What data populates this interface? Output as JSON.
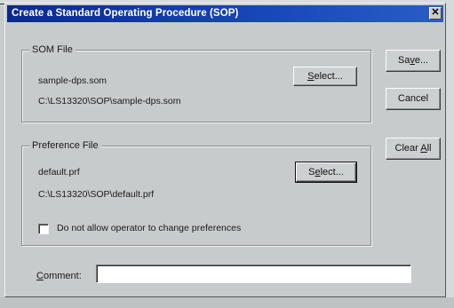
{
  "dialog": {
    "title": "Create a Standard Operating Procedure (SOP)",
    "close_glyph": "✕"
  },
  "som_file": {
    "legend": "SOM File",
    "filename": "sample-dps.som",
    "path": "C:\\LS13320\\SOP\\sample-dps.som",
    "select_prefix": "",
    "select_mnemonic": "S",
    "select_suffix": "elect..."
  },
  "preference_file": {
    "legend": "Preference File",
    "filename": "default.prf",
    "path": "C:\\LS13320\\SOP\\default.prf",
    "select_prefix": "S",
    "select_mnemonic": "e",
    "select_suffix": "lect...",
    "checkbox_label": "Do not allow operator to change preferences",
    "checkbox_checked": false
  },
  "comment": {
    "label_mnemonic": "C",
    "label_rest": "omment:",
    "value": ""
  },
  "buttons": {
    "save_prefix": "Sa",
    "save_mnemonic": "v",
    "save_suffix": "e...",
    "cancel": "Cancel",
    "clear_prefix": "Clear ",
    "clear_mnemonic": "A",
    "clear_suffix": "ll"
  },
  "icons": {
    "close": "close-icon"
  }
}
